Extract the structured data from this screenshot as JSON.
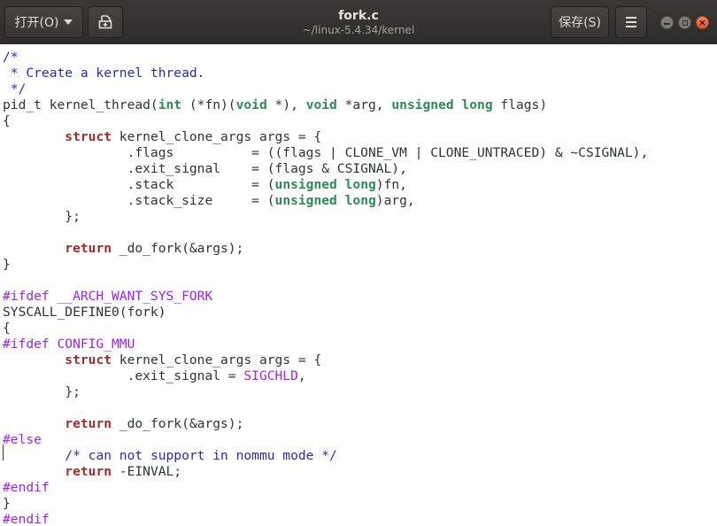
{
  "window": {
    "title": "fork.c",
    "subtitle": "~/linux-5.4.34/kernel"
  },
  "header": {
    "open_label": "打开(O)",
    "save_label": "保存(S)",
    "new_icon": "new-document-icon",
    "menu_icon": "hamburger-menu-icon"
  },
  "window_controls": {
    "minimize_icon": "minimize-icon",
    "maximize_icon": "maximize-icon",
    "close_icon": "close-icon"
  },
  "colors": {
    "titlebar": "#2c2c29",
    "comment": "#2a2ab3",
    "keyword": "#a52a2a",
    "type": "#2e8b57",
    "preprocessor": "#a020f0",
    "close_button": "#e5542a"
  },
  "editor": {
    "lines": [
      [
        {
          "t": "/*",
          "c": "cmt"
        }
      ],
      [
        {
          "t": " * Create a kernel thread.",
          "c": "cmt"
        }
      ],
      [
        {
          "t": " */",
          "c": "cmt"
        }
      ],
      [
        {
          "t": "pid_t kernel_thread("
        },
        {
          "t": "int",
          "c": "ty"
        },
        {
          "t": " (*fn)("
        },
        {
          "t": "void",
          "c": "ty"
        },
        {
          "t": " *), "
        },
        {
          "t": "void",
          "c": "ty"
        },
        {
          "t": " *arg, "
        },
        {
          "t": "unsigned",
          "c": "ty"
        },
        {
          "t": " "
        },
        {
          "t": "long",
          "c": "ty"
        },
        {
          "t": " flags)"
        }
      ],
      [
        {
          "t": "{"
        }
      ],
      [
        {
          "t": "        "
        },
        {
          "t": "struct",
          "c": "kw"
        },
        {
          "t": " kernel_clone_args args = {"
        }
      ],
      [
        {
          "t": "                .flags          = ((flags | CLONE_VM | CLONE_UNTRACED) & ~CSIGNAL),"
        }
      ],
      [
        {
          "t": "                .exit_signal    = (flags & CSIGNAL),"
        }
      ],
      [
        {
          "t": "                .stack          = ("
        },
        {
          "t": "unsigned",
          "c": "ty"
        },
        {
          "t": " "
        },
        {
          "t": "long",
          "c": "ty"
        },
        {
          "t": ")fn,"
        }
      ],
      [
        {
          "t": "                .stack_size     = ("
        },
        {
          "t": "unsigned",
          "c": "ty"
        },
        {
          "t": " "
        },
        {
          "t": "long",
          "c": "ty"
        },
        {
          "t": ")arg,"
        }
      ],
      [
        {
          "t": "        };"
        }
      ],
      [],
      [
        {
          "t": "        "
        },
        {
          "t": "return",
          "c": "kw"
        },
        {
          "t": " _do_fork(&args);"
        }
      ],
      [
        {
          "t": "}"
        }
      ],
      [],
      [
        {
          "t": "#ifdef __ARCH_WANT_SYS_FORK",
          "c": "pp"
        }
      ],
      [
        {
          "t": "SYSCALL_DEFINE0(fork)"
        }
      ],
      [
        {
          "t": "{"
        }
      ],
      [
        {
          "t": "#ifdef CONFIG_MMU",
          "c": "pp"
        }
      ],
      [
        {
          "t": "        "
        },
        {
          "t": "struct",
          "c": "kw"
        },
        {
          "t": " kernel_clone_args args = {"
        }
      ],
      [
        {
          "t": "                .exit_signal = "
        },
        {
          "t": "SIGCHLD",
          "c": "pp"
        },
        {
          "t": ","
        }
      ],
      [
        {
          "t": "        };"
        }
      ],
      [],
      [
        {
          "t": "        "
        },
        {
          "t": "return",
          "c": "kw"
        },
        {
          "t": " _do_fork(&args);"
        }
      ],
      [
        {
          "t": "#else",
          "c": "pp"
        }
      ],
      [
        {
          "t": "        "
        },
        {
          "t": "/* can not support in nommu mode */",
          "c": "cmt"
        }
      ],
      [
        {
          "t": "        "
        },
        {
          "t": "return",
          "c": "kw"
        },
        {
          "t": " -EINVAL;"
        }
      ],
      [
        {
          "t": "#endif",
          "c": "pp"
        }
      ],
      [
        {
          "t": "}"
        }
      ],
      [
        {
          "t": "#endif",
          "c": "pp"
        }
      ]
    ]
  }
}
